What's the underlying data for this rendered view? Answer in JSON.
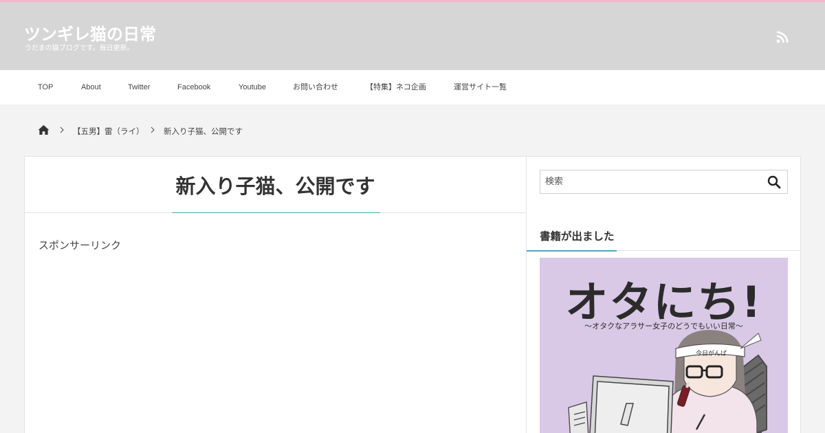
{
  "header": {
    "site_title": "ツンギレ猫の日常",
    "site_description": "うだまの猫ブログです。毎日更新。",
    "rss_icon": "rss-icon"
  },
  "nav": {
    "items": [
      {
        "label": "TOP"
      },
      {
        "label": "About"
      },
      {
        "label": "Twitter"
      },
      {
        "label": "Facebook"
      },
      {
        "label": "Youtube"
      },
      {
        "label": "お問い合わせ"
      },
      {
        "label": "【特集】ネコ企画"
      },
      {
        "label": "運営サイト一覧"
      }
    ]
  },
  "breadcrumb": {
    "home_icon": "home-icon",
    "category": "【五男】雷（ライ）",
    "current": "新入り子猫、公開です"
  },
  "post": {
    "title": "新入り子猫、公開です",
    "sponsor_label": "スポンサーリンク"
  },
  "sidebar": {
    "search": {
      "placeholder": "検索",
      "icon": "search-icon"
    },
    "widget_title": "書籍が出ました",
    "book": {
      "title": "オタにち!",
      "subtitle": "〜オタクなアラサー女子のどうでもいい日常〜",
      "headband_text": "今日がんば"
    }
  },
  "colors": {
    "header_bg": "#d6d6d6",
    "top_border": "#f4b6cd",
    "accent": "#4aa9bd",
    "page_bg": "#f3f3f3",
    "book_bg": "#d9c8e6"
  }
}
